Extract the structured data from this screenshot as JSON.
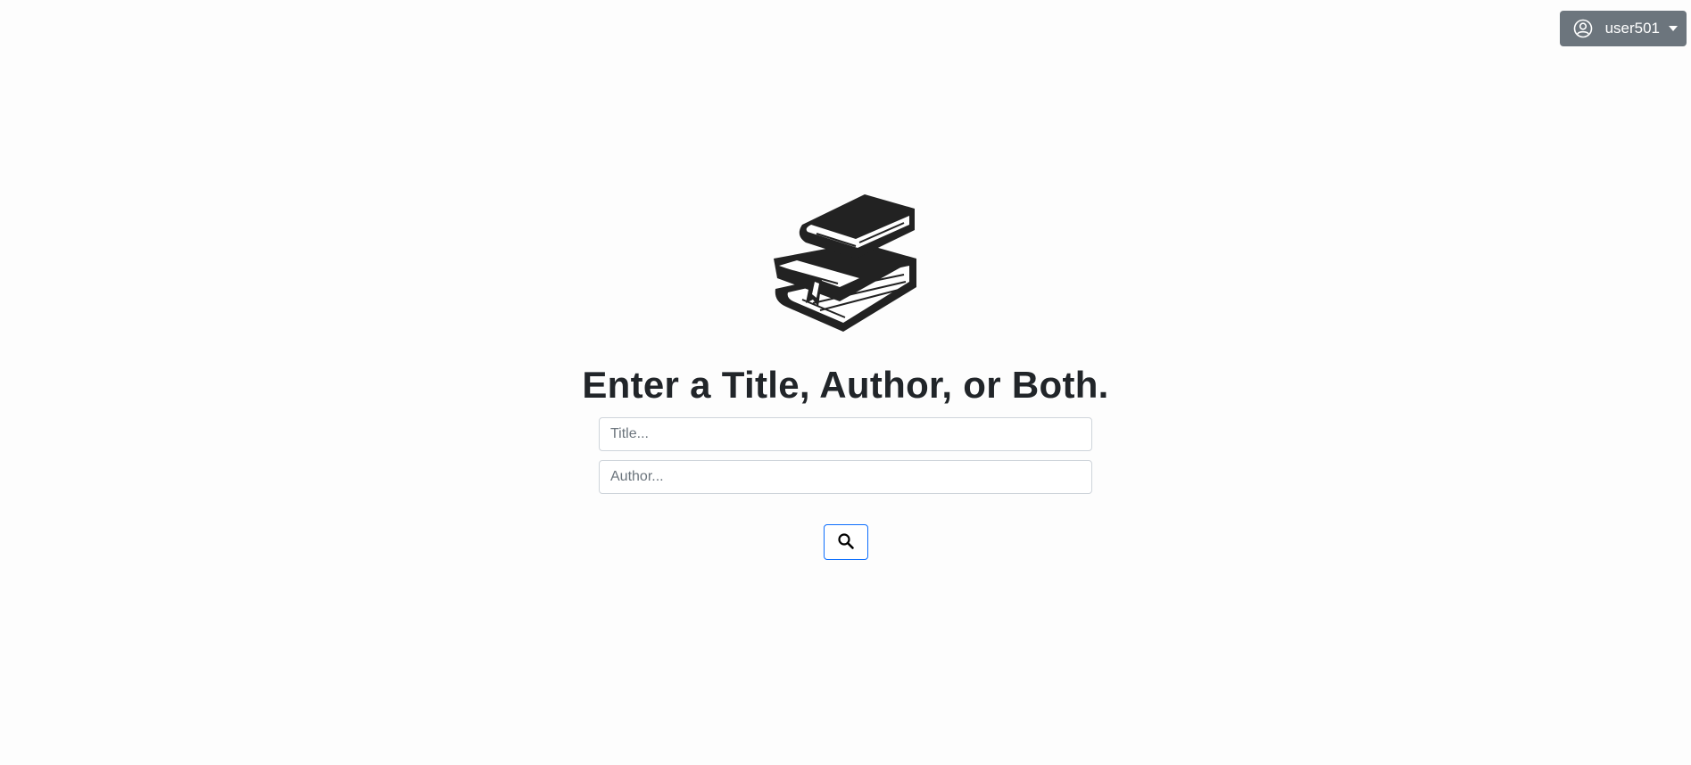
{
  "header": {
    "user_menu": {
      "icon": "user-circle-icon",
      "username": "user501",
      "caret": "chevron-down-icon"
    }
  },
  "main": {
    "logo_icon": "stacked-books-icon",
    "heading": "Enter a Title, Author, or Both.",
    "title_field": {
      "placeholder": "Title...",
      "value": ""
    },
    "author_field": {
      "placeholder": "Author...",
      "value": ""
    },
    "search_button": {
      "icon": "search-icon"
    }
  },
  "colors": {
    "background": "#fdfdfd",
    "user_menu_bg": "#6c757d",
    "text": "#212529",
    "button_border": "#0d6efd"
  }
}
